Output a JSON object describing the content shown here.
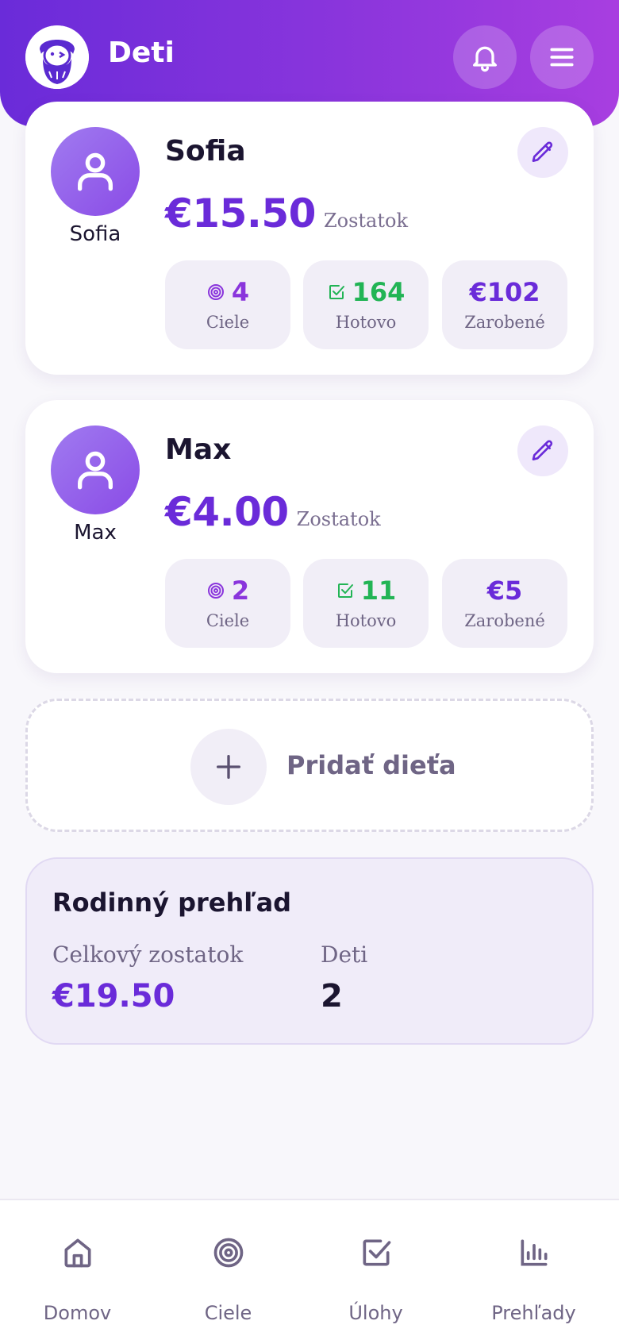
{
  "header": {
    "title": "Deti",
    "logo_icon": "bearded-man-logo-icon",
    "notifications_icon": "bell-icon",
    "menu_icon": "hamburger-menu-icon"
  },
  "children": [
    {
      "avatar_label": "Sofia",
      "name": "Sofia",
      "balance": "€15.50",
      "balance_label": "Zostatok",
      "stats": {
        "goals": {
          "value": "4",
          "label": "Ciele"
        },
        "done": {
          "value": "164",
          "label": "Hotovo"
        },
        "earned": {
          "value": "€102",
          "label": "Zarobené"
        }
      }
    },
    {
      "avatar_label": "Max",
      "name": "Max",
      "balance": "€4.00",
      "balance_label": "Zostatok",
      "stats": {
        "goals": {
          "value": "2",
          "label": "Ciele"
        },
        "done": {
          "value": "11",
          "label": "Hotovo"
        },
        "earned": {
          "value": "€5",
          "label": "Zarobené"
        }
      }
    }
  ],
  "add_child": {
    "label": "Pridať dieťa"
  },
  "summary": {
    "title": "Rodinný prehľad",
    "total_balance_label": "Celkový zostatok",
    "total_balance": "€19.50",
    "children_label": "Deti",
    "children_count": "2"
  },
  "nav": {
    "items": [
      {
        "label": "Domov",
        "icon": "home-icon"
      },
      {
        "label": "Ciele",
        "icon": "target-icon"
      },
      {
        "label": "Úlohy",
        "icon": "checkbox-icon"
      },
      {
        "label": "Prehľady",
        "icon": "bar-chart-icon"
      }
    ]
  },
  "colors": {
    "primary": "#6a2bd9",
    "accent": "#a83ee0",
    "success": "#22b455",
    "muted_text": "#6f6585"
  }
}
